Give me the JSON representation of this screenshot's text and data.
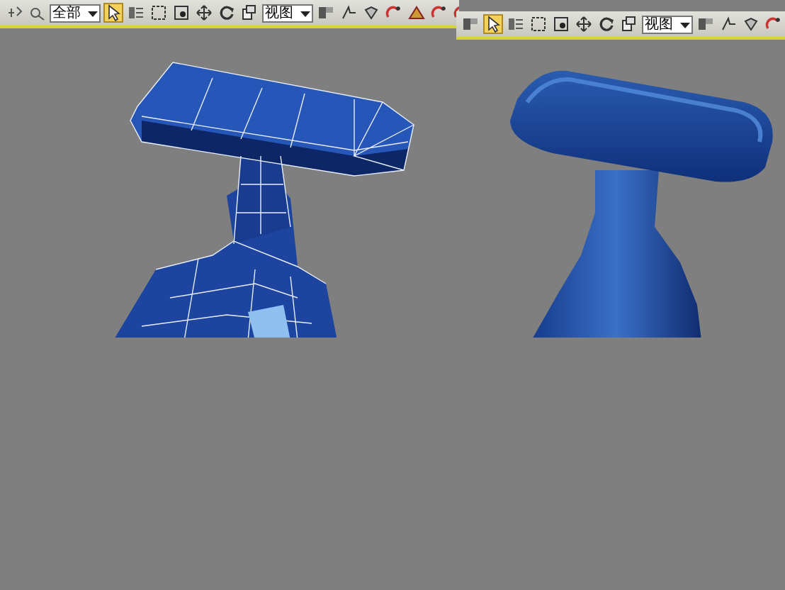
{
  "toolbars": [
    {
      "kind": "main",
      "selection_filter": "全部",
      "select_active": true,
      "reference_coord": "视图"
    },
    {
      "kind": "floating",
      "select_active": true,
      "reference_coord": "视图"
    }
  ],
  "viewport": {
    "models": [
      {
        "kind": "wireframe"
      },
      {
        "kind": "smooth"
      }
    ]
  }
}
